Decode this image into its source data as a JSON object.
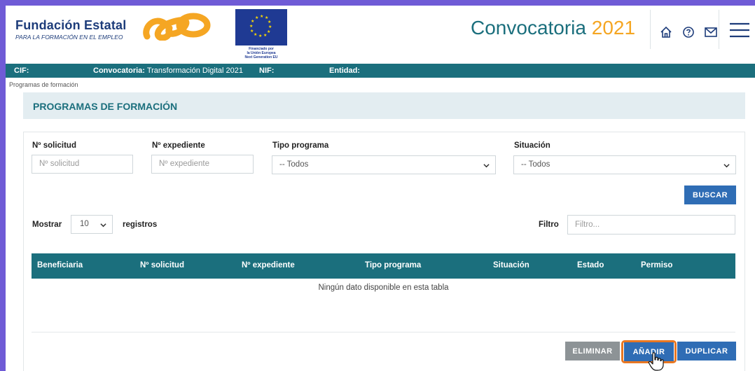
{
  "colors": {
    "frame": "#6f5bd6",
    "teal": "#1b6f7d",
    "navy": "#1d3c7a",
    "orange_accent": "#f5a623",
    "button_blue": "#2f6db5",
    "button_grey": "#8d9396",
    "highlight": "#e87722"
  },
  "header": {
    "brand_name": "Fundación Estatal",
    "brand_subtitle": "PARA LA FORMACIÓN EN EL EMPLEO",
    "eu_caption": [
      "Financiado por",
      "la Unión Europea",
      "Next Generation EU"
    ],
    "title_word": "Convocatoria",
    "title_year": "2021",
    "icons": [
      "home-icon",
      "help-icon",
      "mail-icon",
      "menu-icon"
    ]
  },
  "infobar": {
    "cif_label": "CIF:",
    "convocatoria_label": "Convocatoria:",
    "convocatoria_value": " Transformación Digital 2021",
    "nif_label": "NIF:",
    "entidad_label": "Entidad:"
  },
  "breadcrumb": "Programas de formación",
  "section_title": "PROGRAMAS DE FORMACIÓN",
  "filters": {
    "solicitud_label": "Nº solicitud",
    "solicitud_placeholder": "Nº solicitud",
    "expediente_label": "Nº expediente",
    "expediente_placeholder": "Nº expediente",
    "tipo_label": "Tipo programa",
    "tipo_value": "-- Todos",
    "situacion_label": "Situación",
    "situacion_value": "-- Todos",
    "search_button": "BUSCAR"
  },
  "table_controls": {
    "show_label": "Mostrar",
    "page_length": "10",
    "records_label": "registros",
    "filter_label": "Filtro",
    "filter_placeholder": "Filtro..."
  },
  "table": {
    "columns": [
      "Beneficiaria",
      "Nº solicitud",
      "Nº expediente",
      "Tipo programa",
      "Situación",
      "Estado",
      "Permiso"
    ],
    "empty_message": "Ningún dato disponible en esta tabla"
  },
  "actions": {
    "delete": "ELIMINAR",
    "add": "AÑADIR",
    "duplicate": "DUPLICAR"
  }
}
